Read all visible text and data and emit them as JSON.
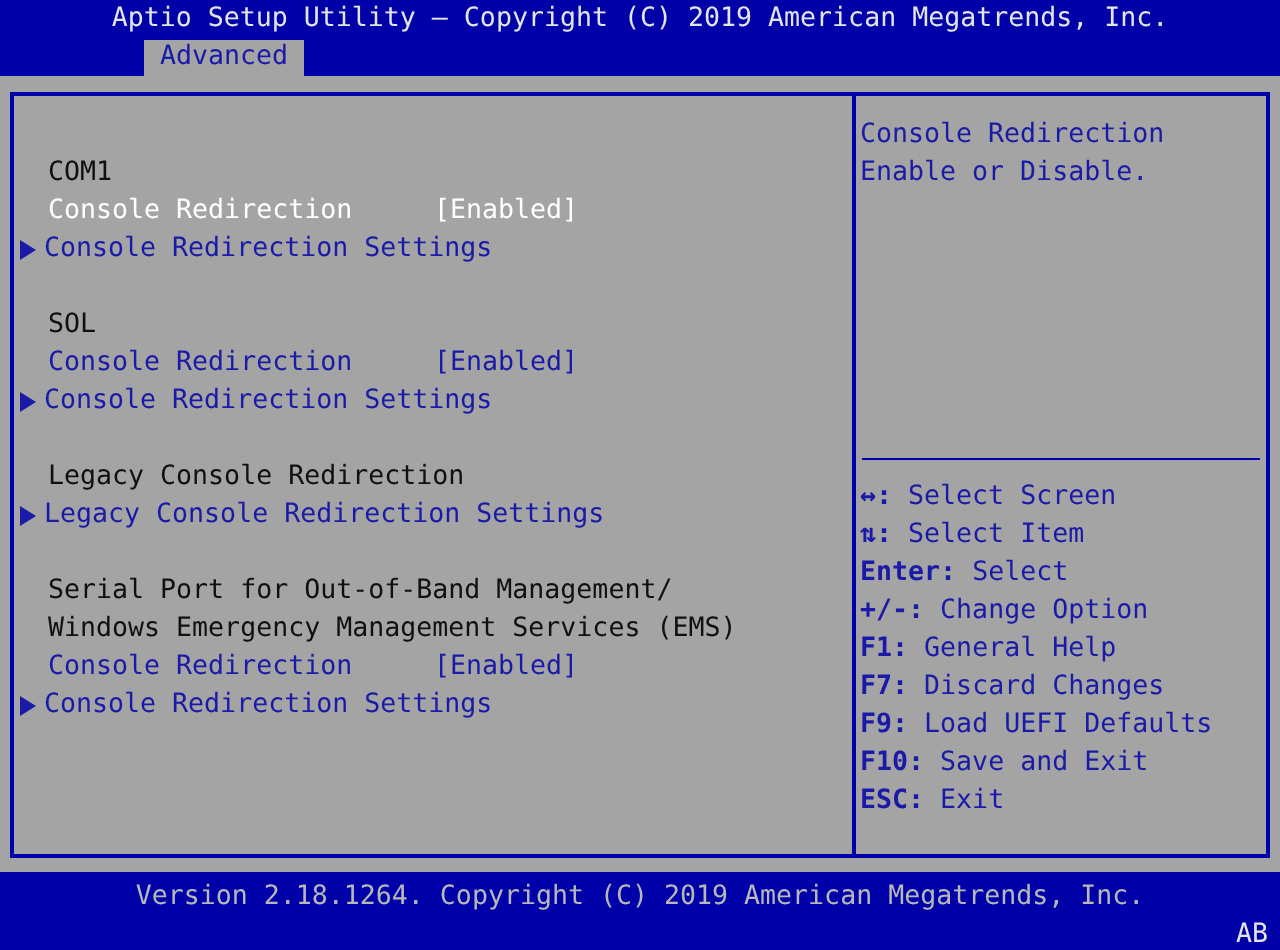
{
  "title": "Aptio Setup Utility – Copyright (C) 2019 American Megatrends, Inc.",
  "tabs": [
    {
      "label": "Advanced",
      "selected": true
    }
  ],
  "groups": [
    {
      "items": [
        {
          "kind": "label",
          "text": "COM1"
        },
        {
          "kind": "option",
          "text": "Console Redirection",
          "value": "[Enabled]",
          "selected": true
        },
        {
          "kind": "submenu",
          "text": "Console Redirection Settings",
          "selected": false
        }
      ]
    },
    {
      "items": [
        {
          "kind": "label",
          "text": "SOL"
        },
        {
          "kind": "option",
          "text": "Console Redirection",
          "value": "[Enabled]",
          "selected": false
        },
        {
          "kind": "submenu",
          "text": "Console Redirection Settings",
          "selected": false
        }
      ]
    },
    {
      "items": [
        {
          "kind": "label",
          "text": "Legacy Console Redirection"
        },
        {
          "kind": "submenu",
          "text": "Legacy Console Redirection Settings",
          "selected": false
        }
      ]
    },
    {
      "items": [
        {
          "kind": "label",
          "text": "Serial Port for Out-of-Band Management/"
        },
        {
          "kind": "label",
          "text": "Windows Emergency Management Services (EMS)"
        },
        {
          "kind": "option",
          "text": "Console Redirection",
          "value": "[Enabled]",
          "selected": false
        },
        {
          "kind": "submenu",
          "text": "Console Redirection Settings",
          "selected": false
        }
      ]
    }
  ],
  "help": [
    "Console Redirection",
    "Enable or Disable."
  ],
  "keys": [
    {
      "key": "↔:",
      "action": "Select Screen"
    },
    {
      "key": "⇅:",
      "action": "Select Item"
    },
    {
      "key": "Enter:",
      "action": "Select"
    },
    {
      "key": "+/-:",
      "action": "Change Option"
    },
    {
      "key": "F1:",
      "action": "General Help"
    },
    {
      "key": "F7:",
      "action": "Discard Changes"
    },
    {
      "key": "F9:",
      "action": "Load UEFI Defaults"
    },
    {
      "key": "F10:",
      "action": "Save and Exit"
    },
    {
      "key": "ESC:",
      "action": "Exit"
    }
  ],
  "footer": "Version 2.18.1264. Copyright (C) 2019 American Megatrends, Inc.",
  "badge": "AB"
}
